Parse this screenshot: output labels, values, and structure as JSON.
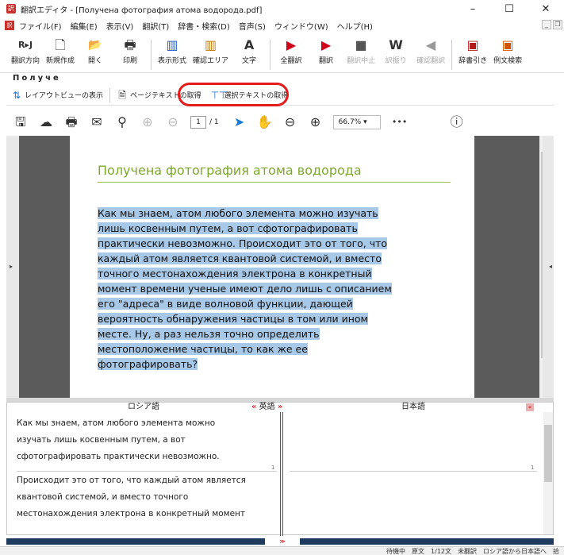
{
  "window": {
    "title": "翻訳エディタ - [Получена фотография атома водорода.pdf]",
    "minimize": "–",
    "maximize": "☐",
    "close": "✕"
  },
  "menu": {
    "items": [
      "ファイル(F)",
      "編集(E)",
      "表示(V)",
      "翻訳(T)",
      "辞書・検索(D)",
      "音声(S)",
      "ウィンドウ(W)",
      "ヘルプ(H)"
    ]
  },
  "toolbar": {
    "buttons": [
      {
        "label": "翻訳方向",
        "icon": "R▸J"
      },
      {
        "label": "新規作成",
        "icon": "🗋"
      },
      {
        "label": "開く",
        "icon": "📂"
      },
      {
        "label": "印刷",
        "icon": "🖶"
      },
      {
        "label": "表示形式",
        "icon": "▥"
      },
      {
        "label": "確認エリア",
        "icon": "▥"
      },
      {
        "label": "文字",
        "icon": "A"
      },
      {
        "label": "全翻訳",
        "icon": "▶"
      },
      {
        "label": "翻訳",
        "icon": "▶"
      },
      {
        "label": "翻訳中止",
        "icon": "■"
      },
      {
        "label": "訳振り",
        "icon": "W"
      },
      {
        "label": "確認翻訳",
        "icon": "◀"
      },
      {
        "label": "辞書引き",
        "icon": "▣"
      },
      {
        "label": "例文検索",
        "icon": "▣"
      }
    ]
  },
  "tab": {
    "label": "Получе"
  },
  "viewer_toolbar": {
    "layout_preview": "レイアウトビューの表示",
    "page_text": "ページテキストの取得",
    "selected_text": "選択テキストの取得"
  },
  "pdf_toolbar": {
    "page_current": "1",
    "page_total": "/ 1",
    "zoom": "66.7%",
    "more": "•••"
  },
  "document": {
    "title": "Получена фотография атома водорода",
    "lines": [
      "Как мы знаем, атом любого элемента можно изучать",
      "лишь косвенным путем, а вот сфотографировать",
      "практически невозможно. Происходит это от того, что",
      "каждый атом является квантовой системой, и вместо",
      "точного местонахождения электрона в конкретный",
      "момент времени ученые имеют дело лишь с описанием",
      "его \"адреса\" в виде волновой функции, дающей",
      "вероятность обнаружения частицы в том или ином",
      "месте. Ну, а раз нельзя точно определить",
      "местоположение частицы, то как же ее",
      "фотографировать?"
    ]
  },
  "panes": {
    "left_header": "ロシア語",
    "switch_label": "英語",
    "switch_left": "«",
    "switch_right": "»",
    "right_header": "日本語",
    "seg1_lines": [
      "Как мы знаем, атом любого элемента можно",
      "изучать лишь косвенным путем, а вот",
      "сфотографировать практически невозможно."
    ],
    "seg1_num": "1",
    "seg2_lines": [
      "Происходит это от того, что каждый атом является",
      "квантовой системой, и вместо точного",
      "местонахождения электрона в конкретный момент"
    ],
    "right_seg1_num": "1"
  },
  "status": {
    "items": [
      "待機中",
      "原文",
      "1/12文",
      "未翻訳",
      "ロシア語から日本語へ",
      "拾"
    ]
  }
}
